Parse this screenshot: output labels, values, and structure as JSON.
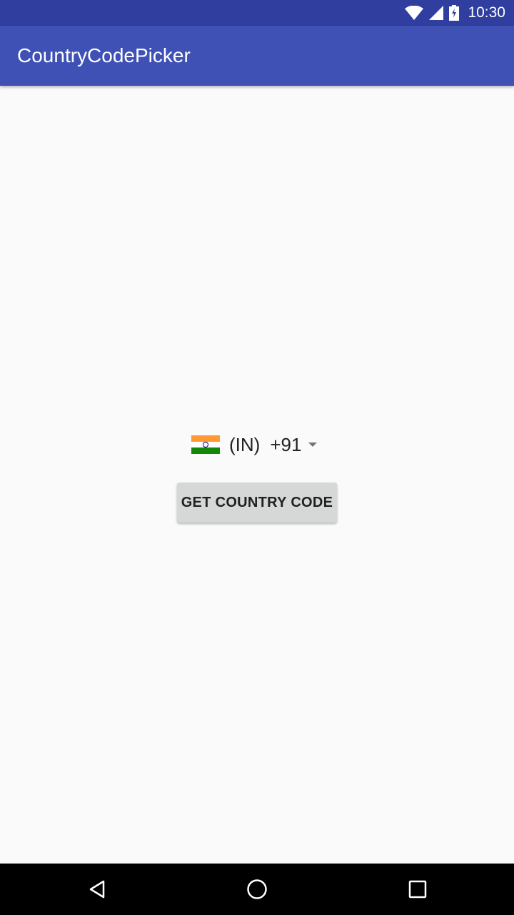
{
  "status_bar": {
    "time": "10:30",
    "icons": [
      "wifi-icon",
      "signal-icon",
      "battery-charging-icon"
    ]
  },
  "app_bar": {
    "title": "CountryCodePicker"
  },
  "country_picker": {
    "flag": "india-flag-icon",
    "name_code": "(IN)",
    "phone_code": "+91",
    "dropdown_icon": "dropdown-arrow-icon"
  },
  "button": {
    "label": "GET COUNTRY CODE"
  },
  "nav_bar": {
    "icons": [
      "back-icon",
      "home-icon",
      "recents-icon"
    ]
  },
  "colors": {
    "status_bar": "#303f9f",
    "app_bar": "#3f51b5",
    "background": "#fafafa",
    "button": "#d6d7d7",
    "flag_saffron": "#ff9933",
    "flag_white": "#ffffff",
    "flag_green": "#138808",
    "flag_chakra": "#000080"
  }
}
